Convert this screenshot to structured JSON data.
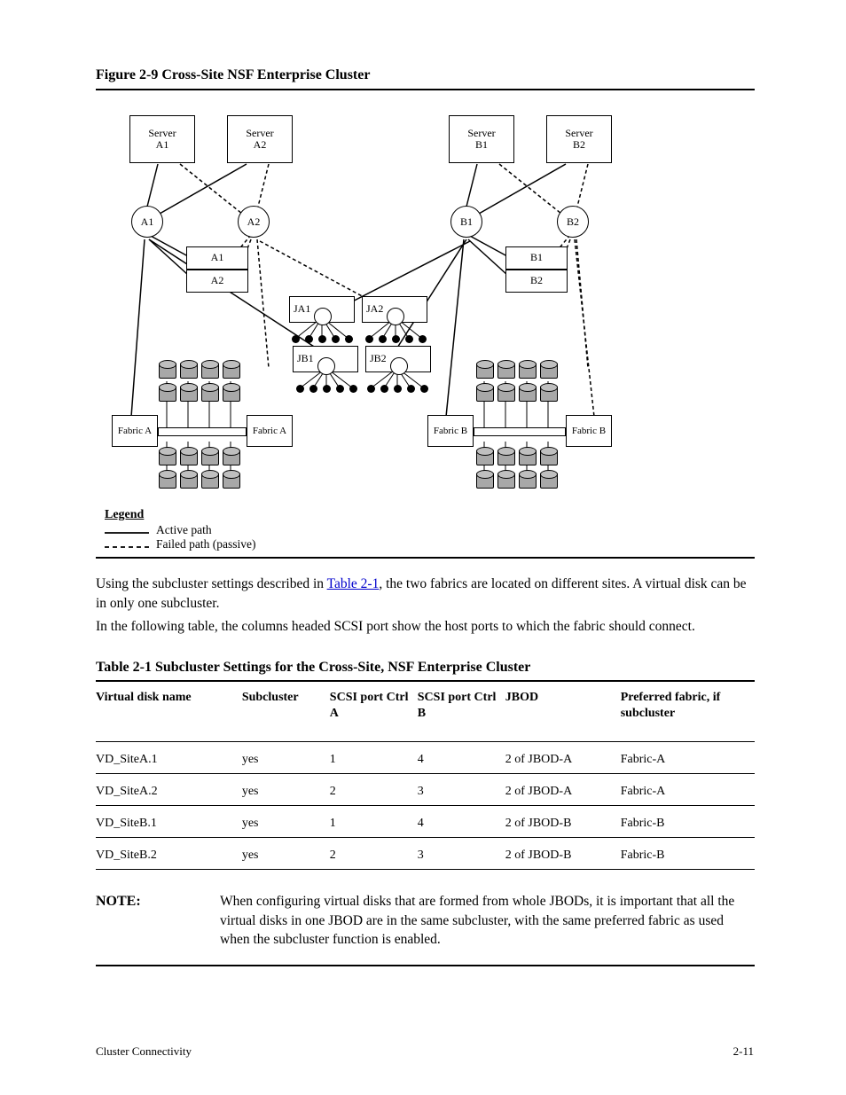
{
  "figure": {
    "title": "Figure 2-9  Cross-Site NSF Enterprise Cluster",
    "nodes": {
      "server_a1": "Server\nA1",
      "server_a2": "Server\nA2",
      "server_b1": "Server\nB1",
      "server_b2": "Server\nB2",
      "fcswitch_a1": "A1",
      "fcswitch_a2": "A2",
      "fcswitch_b1": "B1",
      "fcswitch_b2": "B2",
      "ctrl_a1": "A1",
      "ctrl_a2": "A2",
      "ctrl_b1": "B1",
      "ctrl_b2": "B2",
      "fab_a": "Fabric A",
      "fab_b": "Fabric B",
      "jbod_a1": "JA1",
      "jbod_a2": "JA2",
      "jbod_b1": "JB1",
      "jbod_b2": "JB2"
    },
    "legend": {
      "heading": "Legend",
      "items": [
        {
          "label": "Active path",
          "style": "solid"
        },
        {
          "label": "Failed path (passive)",
          "style": "dashed"
        }
      ]
    }
  },
  "body": {
    "sentence1_pre": "Using the subcluster settings described in ",
    "sentence1_link": "Table 2-1",
    "sentence1_post": ", the two fabrics are located on different sites. A virtual disk can be in only one subcluster.",
    "sentence2": "In the following table, the columns headed SCSI port show the host ports to which the fabric should connect."
  },
  "table": {
    "title": "Table 2-1  Subcluster Settings for the Cross-Site, NSF Enterprise Cluster",
    "headers": [
      "Virtual disk name",
      "Subcluster",
      "SCSI port Ctrl A",
      "SCSI port Ctrl B",
      "JBOD",
      "Preferred fabric, if subcluster"
    ],
    "rows": [
      [
        "VD_SiteA.1",
        "yes",
        "1",
        "4",
        "2 of JBOD-A",
        "Fabric-A"
      ],
      [
        "VD_SiteA.2",
        "yes",
        "2",
        "3",
        "2 of JBOD-A",
        "Fabric-A"
      ],
      [
        "VD_SiteB.1",
        "yes",
        "1",
        "4",
        "2 of JBOD-B",
        "Fabric-B"
      ],
      [
        "VD_SiteB.2",
        "yes",
        "2",
        "3",
        "2 of JBOD-B",
        "Fabric-B"
      ]
    ]
  },
  "note": {
    "label": "NOTE:",
    "text": "When configuring virtual disks that are formed from whole JBODs, it is important that all the virtual disks in one JBOD are in the same subcluster, with the same preferred fabric as used when the subcluster function is enabled."
  },
  "footer": {
    "left": "Cluster Connectivity",
    "right": "2-11"
  }
}
